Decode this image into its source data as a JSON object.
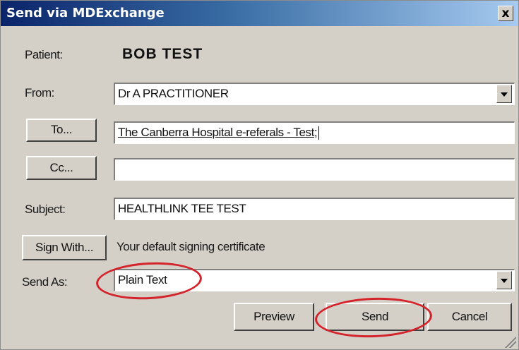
{
  "window": {
    "title": "Send via MDExchange",
    "close_label": "x"
  },
  "patient": {
    "label": "Patient:",
    "name": "BOB TEST"
  },
  "from": {
    "label": "From:",
    "value": "Dr A PRACTITIONER"
  },
  "to": {
    "button_label": "To...",
    "value": "The Canberra Hospital e-referals - Test;"
  },
  "cc": {
    "button_label": "Cc...",
    "value": ""
  },
  "subject": {
    "label": "Subject:",
    "value": "HEALTHLINK TEE TEST"
  },
  "sign": {
    "button_label": "Sign With...",
    "value": "Your default signing certificate"
  },
  "send_as": {
    "label": "Send As:",
    "value": "Plain Text"
  },
  "footer": {
    "preview_label": "Preview",
    "send_label": "Send",
    "cancel_label": "Cancel"
  },
  "annotation_color": "#d4232b"
}
